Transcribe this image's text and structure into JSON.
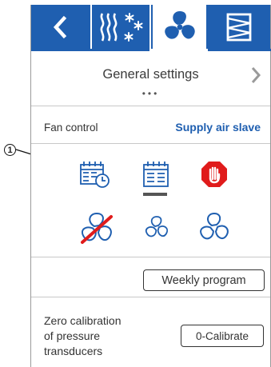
{
  "callout": {
    "label": "1"
  },
  "tabs": [
    {
      "name": "back",
      "icon": "chevron-left-icon"
    },
    {
      "name": "heating",
      "icon": "heat-snow-icon"
    },
    {
      "name": "fan",
      "icon": "fan-icon",
      "selected": true
    },
    {
      "name": "filter",
      "icon": "filter-icon"
    }
  ],
  "general": {
    "title": "General settings",
    "dots": "•••"
  },
  "fan_control": {
    "label": "Fan control",
    "value": "Supply air slave"
  },
  "modes": [
    {
      "icon": "weekly-schedule-clock-icon"
    },
    {
      "icon": "weekly-schedule-icon",
      "selected": true
    },
    {
      "icon": "stop-hand-icon"
    },
    {
      "icon": "fan-off-icon"
    },
    {
      "icon": "fan-low-icon"
    },
    {
      "icon": "fan-high-icon"
    }
  ],
  "weekly_button": "Weekly program",
  "calibration": {
    "line1": "Zero calibration",
    "line2": "of pressure",
    "line3": "transducers",
    "button": "0-Calibrate"
  },
  "colors": {
    "accent": "#1f5fb0",
    "stop": "#e01b1b",
    "text": "#333333"
  }
}
